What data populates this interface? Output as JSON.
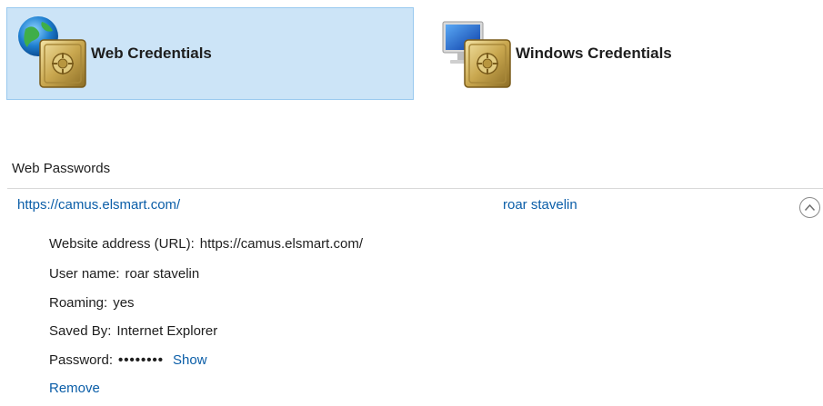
{
  "tiles": {
    "web_credentials": "Web Credentials",
    "windows_credentials": "Windows Credentials"
  },
  "section_title": "Web Passwords",
  "entry": {
    "url": "https://camus.elsmart.com/",
    "user": "roar stavelin",
    "details": {
      "website_address_label": "Website address (URL):",
      "website_address_value": "https://camus.elsmart.com/",
      "user_name_label": "User name:",
      "user_name_value": "roar stavelin",
      "roaming_label": "Roaming:",
      "roaming_value": "yes",
      "saved_by_label": "Saved By:",
      "saved_by_value": "Internet Explorer",
      "password_label": "Password:",
      "password_mask": "••••••••",
      "show_label": "Show",
      "remove_label": "Remove"
    }
  },
  "icons": {
    "web_tile_icon": "globe-vault-icon",
    "windows_tile_icon": "monitor-vault-icon",
    "collapse_icon": "chevron-up-icon"
  },
  "colors": {
    "selected_tile_bg": "#cce4f7",
    "link": "#0b5ea8"
  }
}
